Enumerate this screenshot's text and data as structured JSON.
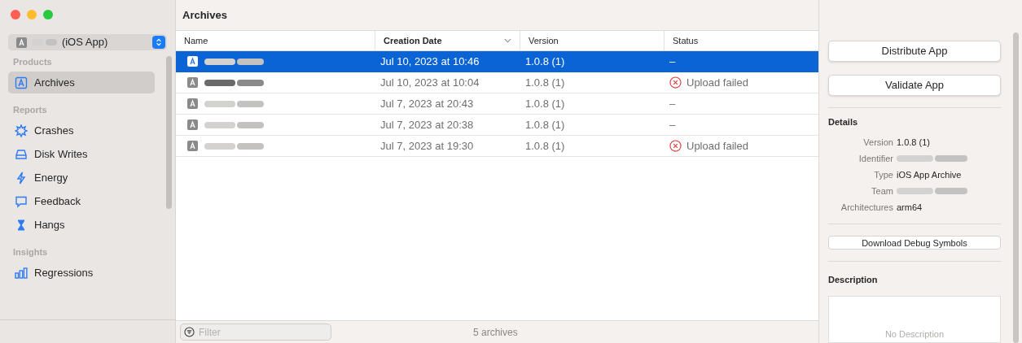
{
  "scheme": {
    "label": "(iOS App)"
  },
  "sidebar": {
    "sections": [
      {
        "title": "Products",
        "items": [
          {
            "label": "Archives",
            "kind": "archive",
            "selected": true
          }
        ]
      },
      {
        "title": "Reports",
        "items": [
          {
            "label": "Crashes",
            "kind": "crash",
            "selected": false
          },
          {
            "label": "Disk Writes",
            "kind": "disk",
            "selected": false
          },
          {
            "label": "Energy",
            "kind": "energy",
            "selected": false
          },
          {
            "label": "Feedback",
            "kind": "feedback",
            "selected": false
          },
          {
            "label": "Hangs",
            "kind": "hang",
            "selected": false
          }
        ]
      },
      {
        "title": "Insights",
        "items": [
          {
            "label": "Regressions",
            "kind": "regress",
            "selected": false
          }
        ]
      }
    ]
  },
  "main": {
    "title": "Archives",
    "table": {
      "columns": [
        {
          "label": "Name",
          "sorted": false
        },
        {
          "label": "Creation Date",
          "sorted": true
        },
        {
          "label": "Version",
          "sorted": false
        },
        {
          "label": "Status",
          "sorted": false
        }
      ],
      "rows": [
        {
          "date": "Jul 10, 2023 at 10:46",
          "version": "1.0.8 (1)",
          "status": {
            "kind": "none",
            "text": "–"
          },
          "selected": true
        },
        {
          "date": "Jul 10, 2023 at 10:04",
          "version": "1.0.8 (1)",
          "status": {
            "kind": "failed",
            "text": "Upload failed"
          },
          "selected": false
        },
        {
          "date": "Jul 7, 2023 at 20:43",
          "version": "1.0.8 (1)",
          "status": {
            "kind": "none",
            "text": "–"
          },
          "selected": false
        },
        {
          "date": "Jul 7, 2023 at 20:38",
          "version": "1.0.8 (1)",
          "status": {
            "kind": "none",
            "text": "–"
          },
          "selected": false
        },
        {
          "date": "Jul 7, 2023 at 19:30",
          "version": "1.0.8 (1)",
          "status": {
            "kind": "failed",
            "text": "Upload failed"
          },
          "selected": false
        }
      ]
    },
    "filter": {
      "placeholder": "Filter"
    },
    "count": "5 archives"
  },
  "inspector": {
    "buttons": [
      "Distribute App",
      "Validate App"
    ],
    "details_title": "Details",
    "details": [
      {
        "label": "Version",
        "value": "1.0.8 (1)"
      },
      {
        "label": "Identifier"
      },
      {
        "label": "Type",
        "value": "iOS App Archive"
      },
      {
        "label": "Team"
      },
      {
        "label": "Architectures",
        "value": "arm64"
      }
    ],
    "debug_button": "Download Debug Symbols",
    "description_title": "Description",
    "description_placeholder": "No Description"
  }
}
